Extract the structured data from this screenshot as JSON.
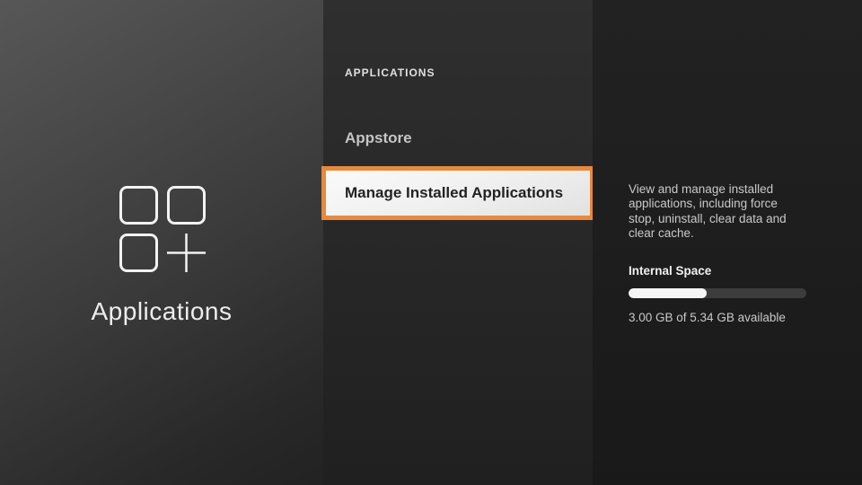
{
  "left_panel": {
    "title": "Applications",
    "icon": "apps-grid-icon"
  },
  "menu_panel": {
    "header": "APPLICATIONS",
    "items": [
      {
        "label": "Appstore",
        "selected": false
      },
      {
        "label": "Manage Installed Applications",
        "selected": true
      }
    ]
  },
  "detail_panel": {
    "description": "View and manage installed applications, including force stop, uninstall, clear data and clear cache.",
    "storage": {
      "label": "Internal Space",
      "available_text": "3.00 GB of 5.34 GB available",
      "used_percent": 44
    }
  },
  "colors": {
    "accent_orange": "#e8893c",
    "selected_item_bg": "#f0f0f0",
    "selected_item_text": "#222222",
    "progress_fill": "#f5f5f5",
    "progress_track": "#3c3c3c"
  }
}
